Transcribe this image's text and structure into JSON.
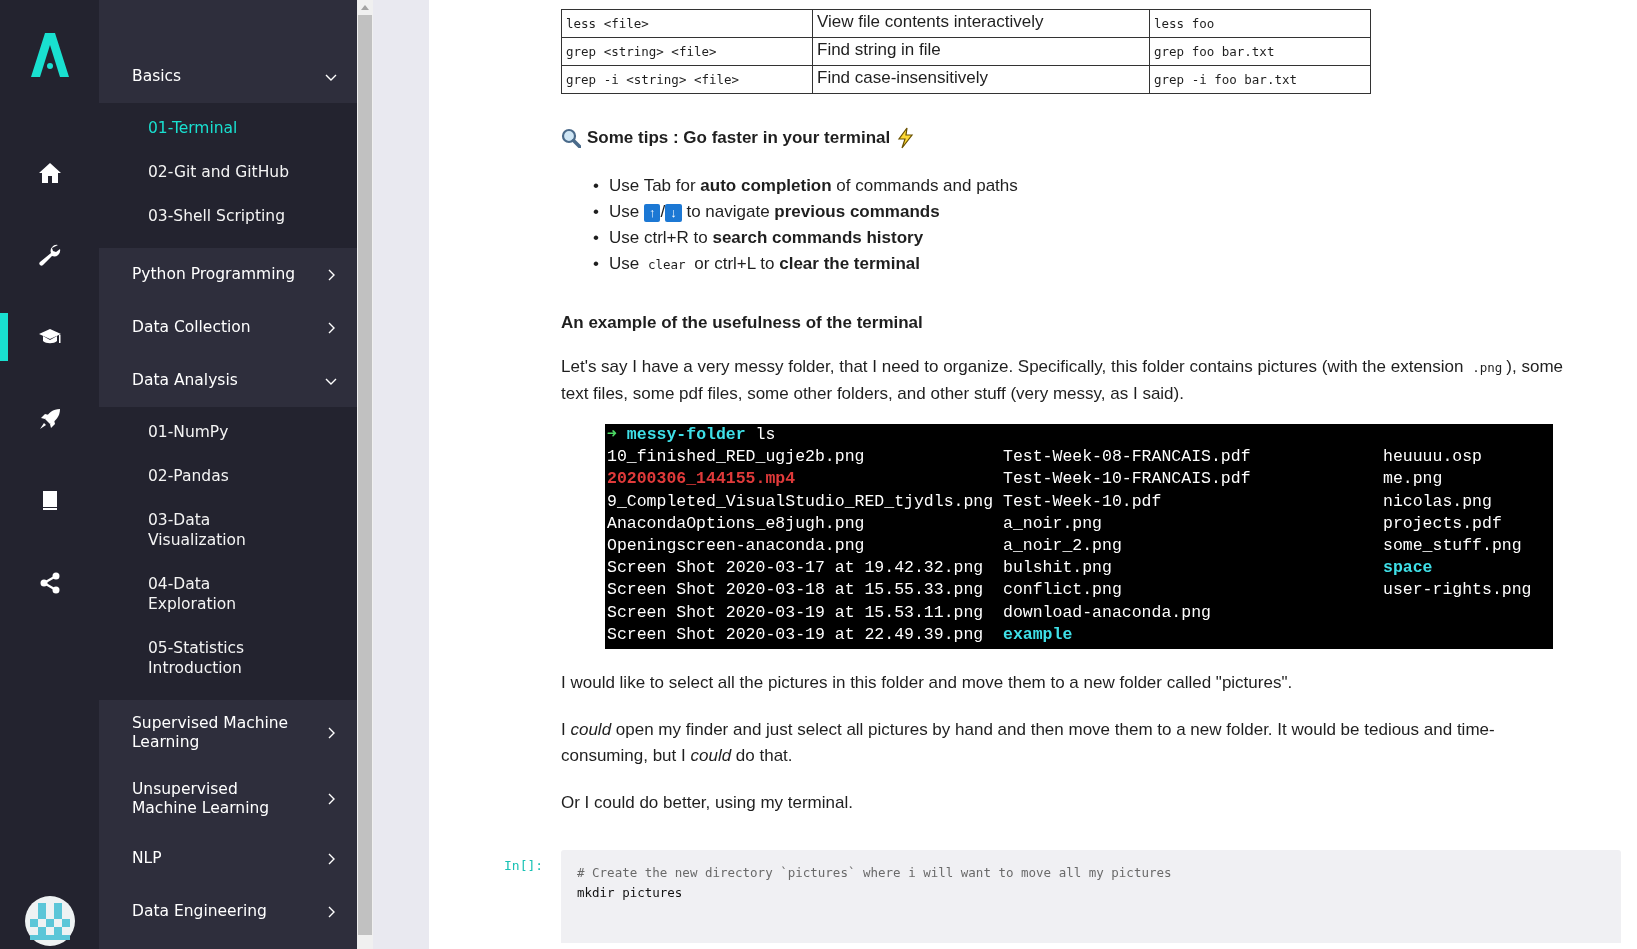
{
  "rail": {
    "icons": [
      {
        "kind": "home",
        "selected": false
      },
      {
        "kind": "wrench",
        "selected": false
      },
      {
        "kind": "cap",
        "selected": true
      },
      {
        "kind": "rocket",
        "selected": false
      },
      {
        "kind": "book",
        "selected": false
      },
      {
        "kind": "share",
        "selected": false
      }
    ]
  },
  "nav": [
    {
      "label": "Basics",
      "expanded": true,
      "children": [
        {
          "label": "01-Terminal",
          "selected": true
        },
        {
          "label": "02-Git and GitHub",
          "selected": false
        },
        {
          "label": "03-Shell Scripting",
          "selected": false
        }
      ]
    },
    {
      "label": "Python Programming",
      "expanded": false
    },
    {
      "label": "Data Collection",
      "expanded": false
    },
    {
      "label": "Data Analysis",
      "expanded": true,
      "children": [
        {
          "label": "01-NumPy",
          "selected": false
        },
        {
          "label": "02-Pandas",
          "selected": false
        },
        {
          "label": "03-Data Visualization",
          "selected": false
        },
        {
          "label": "04-Data Exploration",
          "selected": false
        },
        {
          "label": "05-Statistics Introduction",
          "selected": false
        }
      ]
    },
    {
      "label": "Supervised Machine Learning",
      "expanded": false
    },
    {
      "label": "Unsupervised Machine Learning",
      "expanded": false
    },
    {
      "label": "NLP",
      "expanded": false
    },
    {
      "label": "Data Engineering",
      "expanded": false
    }
  ],
  "table": {
    "rows": [
      [
        "less <file>",
        "View file contents interactively",
        "less foo"
      ],
      [
        "grep <string> <file>",
        "Find string in file",
        "grep foo bar.txt"
      ],
      [
        "grep -i <string> <file>",
        "Find case-insensitively",
        "grep -i foo bar.txt"
      ]
    ]
  },
  "tips_heading": "Some tips : Go faster in your terminal",
  "tips": [
    [
      {
        "kind": "marker",
        "text": "•"
      },
      {
        "kind": "text",
        "text": "Use Tab for **auto completion** of commands and paths"
      }
    ],
    [
      {
        "kind": "marker",
        "text": "•"
      },
      {
        "kind": "text",
        "text": "Use "
      },
      {
        "kind": "key",
        "text": "↑"
      },
      {
        "kind": "text",
        "text": "/"
      },
      {
        "kind": "key",
        "text": "↓"
      },
      {
        "kind": "text",
        "text": " to navigate **previous commands**"
      }
    ],
    [
      {
        "kind": "marker",
        "text": "•"
      },
      {
        "kind": "text",
        "text": "Use ctrl+R to **search commands history**"
      }
    ],
    [
      {
        "kind": "marker",
        "text": "•"
      },
      {
        "kind": "text",
        "text": "Use "
      },
      {
        "kind": "code",
        "text": "clear"
      },
      {
        "kind": "text",
        "text": " or ctrl+L to **clear the terminal**"
      }
    ]
  ],
  "example_heading": "An example of the usefulness of the terminal",
  "intro": [
    {
      "kind": "text",
      "text": "Let's say I have a very messy folder, that I need to organize. Specifically, this folder contains pictures (with the extension "
    },
    {
      "kind": "code",
      "text": ".png"
    },
    {
      "kind": "text",
      "text": "), some text files, some pdf files, some other folders, and other stuff (very messy, as I said)."
    }
  ],
  "terminal": {
    "prompt_arrow": "➜",
    "prompt_dir": "messy-folder",
    "command": "ls",
    "columns": [
      [
        {
          "text": "10_finished_RED_ugje2b.png",
          "color": "#ffffff"
        },
        {
          "text": "20200306_144155.mp4",
          "color": "#e03a3a"
        },
        {
          "text": "9_Completed_VisualStudio_RED_tjydls.png",
          "color": "#ffffff"
        },
        {
          "text": "AnacondaOptions_e8jugh.png",
          "color": "#ffffff"
        },
        {
          "text": "Openingscreen-anaconda.png",
          "color": "#ffffff"
        },
        {
          "text": "Screen Shot 2020-03-17 at 19.42.32.png",
          "color": "#ffffff"
        },
        {
          "text": "Screen Shot 2020-03-18 at 15.55.33.png",
          "color": "#ffffff"
        },
        {
          "text": "Screen Shot 2020-03-19 at 15.53.11.png",
          "color": "#ffffff"
        },
        {
          "text": "Screen Shot 2020-03-19 at 22.49.39.png",
          "color": "#ffffff"
        }
      ],
      [
        {
          "text": "Test-Week-08-FRANCAIS.pdf",
          "color": "#ffffff"
        },
        {
          "text": "Test-Week-10-FRANCAIS.pdf",
          "color": "#ffffff"
        },
        {
          "text": "Test-Week-10.pdf",
          "color": "#ffffff"
        },
        {
          "text": "a_noir.png",
          "color": "#ffffff"
        },
        {
          "text": "a_noir_2.png",
          "color": "#ffffff"
        },
        {
          "text": "bulshit.png",
          "color": "#ffffff"
        },
        {
          "text": "conflict.png",
          "color": "#ffffff"
        },
        {
          "text": "download-anaconda.png",
          "color": "#ffffff"
        },
        {
          "text": "example",
          "color": "#3fe0e8"
        }
      ],
      [
        {
          "text": "heuuuu.osp",
          "color": "#ffffff"
        },
        {
          "text": "me.png",
          "color": "#ffffff"
        },
        {
          "text": "nicolas.png",
          "color": "#ffffff"
        },
        {
          "text": "projects.pdf",
          "color": "#ffffff"
        },
        {
          "text": "some_stuff.png",
          "color": "#ffffff"
        },
        {
          "text": "space",
          "color": "#3fe0e8"
        },
        {
          "text": "user-rights.png",
          "color": "#ffffff"
        }
      ]
    ]
  },
  "paragraphs": [
    "I would like to select all the pictures in this folder and move them to a new folder called \"pictures\".",
    "I *could* open my finder and just select all pictures by hand and then move them to a new folder. It would be tedious and time-consuming, but I *could* do that.",
    "Or I could do better, using my terminal."
  ],
  "code_cell": {
    "prompt": "In[]:",
    "lines": [
      {
        "kind": "comment",
        "text": "# Create the new directory `pictures` where i will want to move all my pictures"
      },
      {
        "kind": "code",
        "text": "mkdir pictures"
      }
    ]
  }
}
